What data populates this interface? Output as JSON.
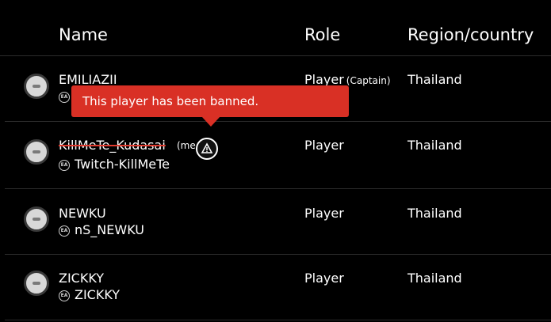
{
  "table": {
    "headers": {
      "name": "Name",
      "role": "Role",
      "region": "Region/country"
    },
    "rows": [
      {
        "player_name": "EMILIAZII",
        "game_id": "",
        "role": "Player",
        "role_tag": "(Captain)",
        "region": "Thailand",
        "avatar_icon": "default-avatar-icon",
        "platform_icon": "ea-icon",
        "banned": false
      },
      {
        "player_name": "KillMeTe_Kudasai",
        "name_suffix": "(me",
        "game_id": "Twitch-KillMeTe",
        "role": "Player",
        "role_tag": "",
        "region": "Thailand",
        "avatar_icon": "default-avatar-icon",
        "platform_icon": "ea-icon",
        "status_icon": "banned-warning-icon",
        "banned": true
      },
      {
        "player_name": "NEWKU",
        "game_id": "nS_NEWKU",
        "role": "Player",
        "role_tag": "",
        "region": "Thailand",
        "avatar_icon": "default-avatar-icon",
        "platform_icon": "ea-icon",
        "banned": false
      },
      {
        "player_name": "ZICKKY",
        "game_id": "ZICKKY",
        "role": "Player",
        "role_tag": "",
        "region": "Thailand",
        "avatar_icon": "default-avatar-icon",
        "platform_icon": "ea-icon",
        "banned": false
      }
    ]
  },
  "tooltip": {
    "text": "This player has been banned."
  },
  "colors": {
    "background": "#000000",
    "text": "#ffffff",
    "divider": "#2b2b2b",
    "tooltip_bg": "#d93025",
    "strike": "#e03a2e"
  }
}
